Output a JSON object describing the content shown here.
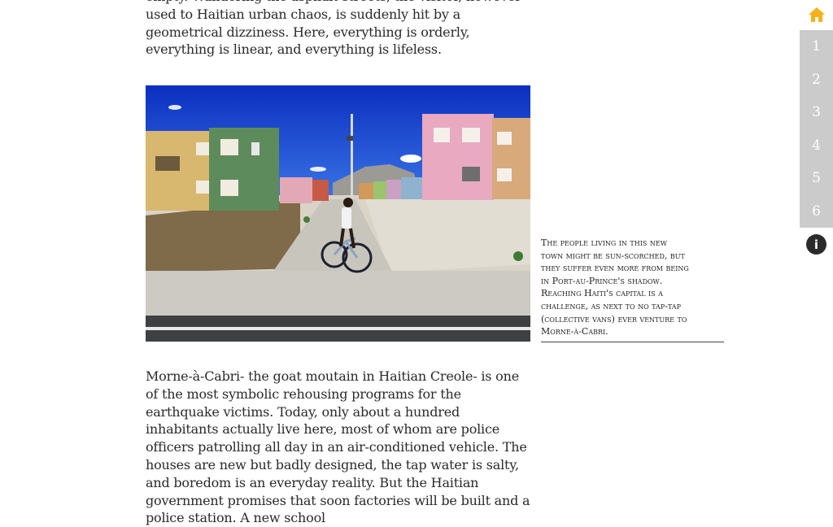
{
  "article": {
    "paragraph_top": "empty. Wandering the asphalt streets, the visitor, however used to Haitian urban chaos, is suddenly hit by a geometrical dizziness. Here, everything is orderly, everything is linear, and everything is lifeless.",
    "paragraph_bottom": "Morne-à-Cabri- the goat moutain in Haitian Creole- is one of the most symbolic rehousing programs for the earthquake victims. Today, only about a hundred inhabitants actually live here, most of whom are police officers patrolling all day in an air-conditioned vehicle. The houses are new but badly designed, the tap water is salty, and boredom is an everyday reality. But the Haitian government promises that soon factories will be built and a police station. A new school"
  },
  "caption": {
    "text": "The people living in this new town might be sun-scorched, but they suffer even more from being in Port-au-Prince's shadow. Reaching Haiti's capital is a challenge, as next to no tap-tap (collective vans) ever venture to Morne-à-Cabri."
  },
  "nav": {
    "home_icon": "house-icon",
    "pages": [
      "1",
      "2",
      "3",
      "4",
      "5",
      "6"
    ],
    "info_label": "i",
    "colors": {
      "home": "#f2b21b",
      "pages_bg": "#cbcbcb",
      "page_text": "#ffffff",
      "info_bg": "#2b2b2b"
    }
  }
}
